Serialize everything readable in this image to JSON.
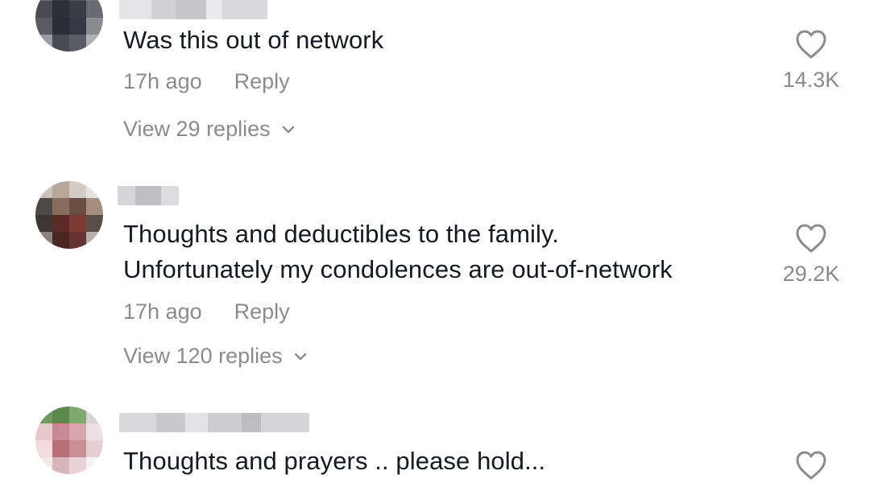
{
  "comments": [
    {
      "text": "Was this out of network",
      "time": "17h ago",
      "reply": "Reply",
      "view_replies": "View 29 replies",
      "likes": "14.3K"
    },
    {
      "text": "Thoughts and deductibles to the family.\nUnfortunately my condolences are out-of-network",
      "time": "17h ago",
      "reply": "Reply",
      "view_replies": "View 120 replies",
      "likes": "29.2K"
    },
    {
      "text": "Thoughts and prayers .. please hold..."
    }
  ],
  "icons": {
    "like": "heart-outline-icon",
    "expand": "chevron-down-icon"
  },
  "colors": {
    "text": "#161823",
    "secondary": "#8a8b91",
    "background": "#ffffff"
  }
}
